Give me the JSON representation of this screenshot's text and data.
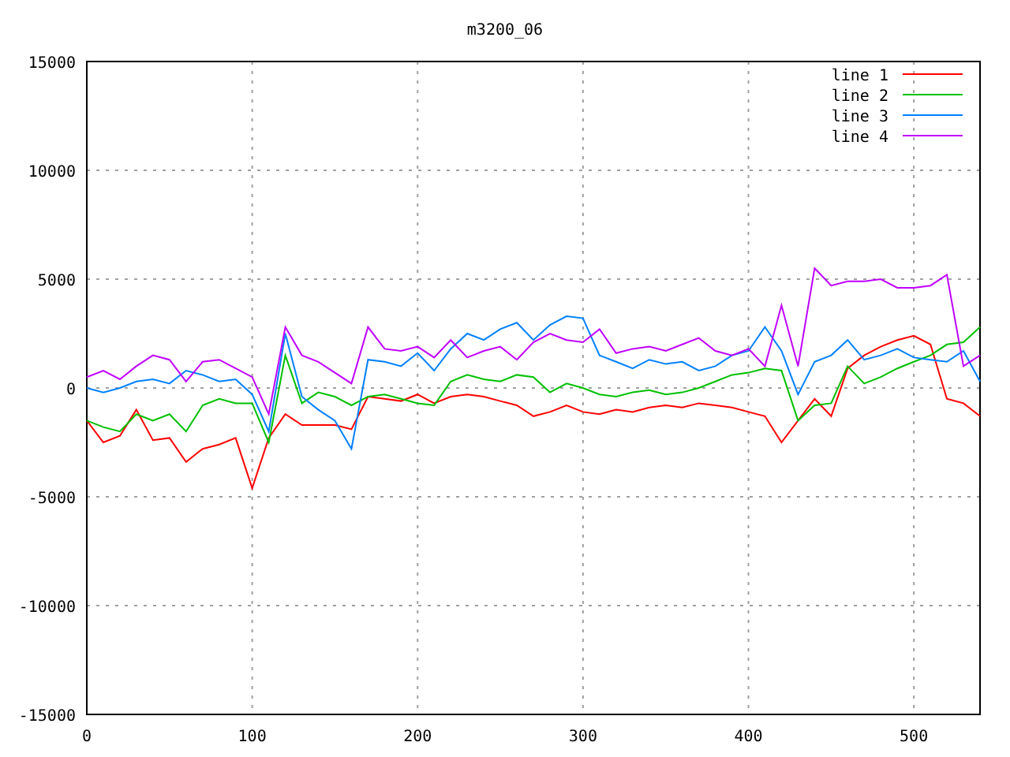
{
  "chart_data": {
    "type": "line",
    "title": "m3200_06",
    "grid": true,
    "legend": "upper right",
    "xlim": [
      0,
      540
    ],
    "ylim": [
      -15000,
      15000
    ],
    "xticks": [
      0,
      100,
      200,
      300,
      400,
      500
    ],
    "yticks": [
      -15000,
      -10000,
      -5000,
      0,
      5000,
      10000,
      15000
    ],
    "x": [
      0,
      10,
      20,
      30,
      40,
      50,
      60,
      70,
      80,
      90,
      100,
      110,
      120,
      130,
      140,
      150,
      160,
      170,
      180,
      190,
      200,
      210,
      220,
      230,
      240,
      250,
      260,
      270,
      280,
      290,
      300,
      310,
      320,
      330,
      340,
      350,
      360,
      370,
      380,
      390,
      400,
      410,
      420,
      430,
      440,
      450,
      460,
      470,
      480,
      490,
      500,
      510,
      520,
      530,
      540
    ],
    "series": [
      {
        "name": "line 1",
        "color": "#ff0000",
        "values": [
          -1500,
          -2500,
          -2200,
          -1000,
          -2400,
          -2300,
          -3400,
          -2800,
          -2600,
          -2300,
          -4600,
          -2300,
          -1200,
          -1700,
          -1700,
          -1700,
          -1900,
          -400,
          -500,
          -600,
          -300,
          -700,
          -400,
          -300,
          -400,
          -600,
          -800,
          -1300,
          -1100,
          -800,
          -1100,
          -1200,
          -1000,
          -1100,
          -900,
          -800,
          -900,
          -700,
          -800,
          -900,
          -1100,
          -1300,
          -2500,
          -1500,
          -500,
          -1300,
          900,
          1500,
          1900,
          2200,
          2400,
          2000,
          -500,
          -700,
          -1300
        ]
      },
      {
        "name": "line 2",
        "color": "#00c000",
        "values": [
          -1500,
          -1800,
          -2000,
          -1200,
          -1500,
          -1200,
          -2000,
          -800,
          -500,
          -700,
          -700,
          -2500,
          1500,
          -700,
          -200,
          -400,
          -800,
          -400,
          -300,
          -500,
          -700,
          -800,
          300,
          600,
          400,
          300,
          600,
          500,
          -200,
          200,
          0,
          -300,
          -400,
          -200,
          -100,
          -300,
          -200,
          0,
          300,
          600,
          700,
          900,
          800,
          -1500,
          -800,
          -700,
          1000,
          200,
          500,
          900,
          1200,
          1500,
          2000,
          2100,
          2800
        ]
      },
      {
        "name": "line 3",
        "color": "#0080ff",
        "values": [
          0,
          -200,
          0,
          300,
          400,
          200,
          800,
          600,
          300,
          400,
          -300,
          -2000,
          2500,
          -400,
          -1000,
          -1500,
          -2800,
          1300,
          1200,
          1000,
          1600,
          800,
          1800,
          2500,
          2200,
          2700,
          3000,
          2200,
          2900,
          3300,
          3200,
          1500,
          1200,
          900,
          1300,
          1100,
          1200,
          800,
          1000,
          1500,
          1700,
          2800,
          1700,
          -300,
          1200,
          1500,
          2200,
          1300,
          1500,
          1800,
          1400,
          1300,
          1200,
          1700,
          300
        ]
      },
      {
        "name": "line 4",
        "color": "#c000ff",
        "values": [
          500,
          800,
          400,
          1000,
          1500,
          1300,
          300,
          1200,
          1300,
          900,
          500,
          -1200,
          2800,
          1500,
          1200,
          700,
          200,
          2800,
          1800,
          1700,
          1900,
          1400,
          2200,
          1400,
          1700,
          1900,
          1300,
          2100,
          2500,
          2200,
          2100,
          2700,
          1600,
          1800,
          1900,
          1700,
          2000,
          2300,
          1700,
          1500,
          1800,
          1000,
          3800,
          1000,
          5500,
          4700,
          4900,
          4900,
          5000,
          4600,
          4600,
          4700,
          5200,
          1000,
          1500
        ]
      }
    ]
  }
}
